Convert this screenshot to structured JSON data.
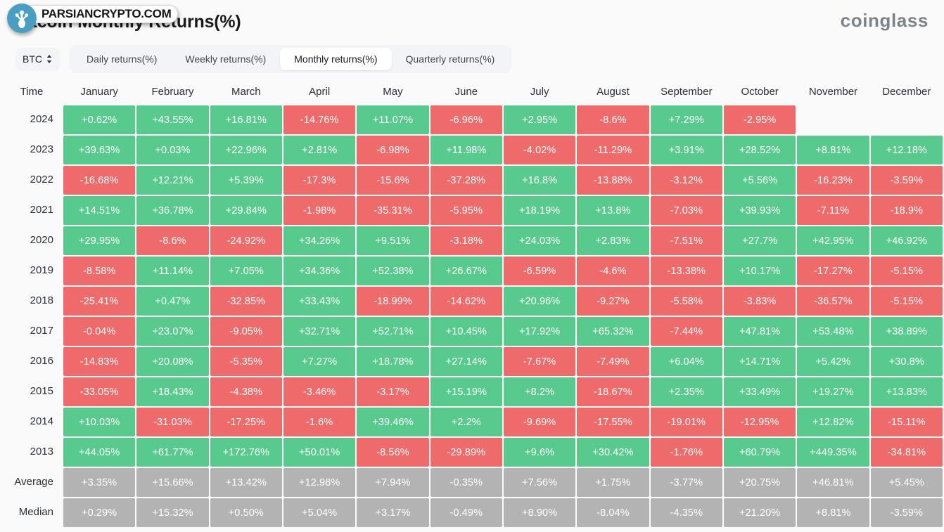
{
  "header": {
    "title": "Bitcoin Monthly Returns(%)",
    "brand": "coinglass"
  },
  "watermark": {
    "text": "PARSIANCRYPTO.COM",
    "logo_icon": "parsian-crypto-logo-icon"
  },
  "controls": {
    "coin": "BTC",
    "coin_stepper_icon": "chevron-updown-icon",
    "tabs": [
      {
        "label": "Daily returns(%)",
        "active": false
      },
      {
        "label": "Weekly returns(%)",
        "active": false
      },
      {
        "label": "Monthly returns(%)",
        "active": true
      },
      {
        "label": "Quarterly returns(%)",
        "active": false
      }
    ]
  },
  "colors": {
    "positive": "#58ca8e",
    "negative": "#ef6a6a",
    "stat": "#b3b3b3",
    "background": "#fafafa"
  },
  "chart_data": {
    "type": "heatmap",
    "title": "Bitcoin Monthly Returns(%)",
    "xlabel": "",
    "ylabel": "Time",
    "columns": [
      "Time",
      "January",
      "February",
      "March",
      "April",
      "May",
      "June",
      "July",
      "August",
      "September",
      "October",
      "November",
      "December"
    ],
    "rows": [
      {
        "label": "2024",
        "kind": "data",
        "values": [
          "+0.62%",
          "+43.55%",
          "+16.81%",
          "-14.76%",
          "+11.07%",
          "-6.96%",
          "+2.95%",
          "-8.6%",
          "+7.29%",
          "-2.95%",
          "",
          ""
        ]
      },
      {
        "label": "2023",
        "kind": "data",
        "values": [
          "+39.63%",
          "+0.03%",
          "+22.96%",
          "+2.81%",
          "-6.98%",
          "+11.98%",
          "-4.02%",
          "-11.29%",
          "+3.91%",
          "+28.52%",
          "+8.81%",
          "+12.18%"
        ]
      },
      {
        "label": "2022",
        "kind": "data",
        "values": [
          "-16.68%",
          "+12.21%",
          "+5.39%",
          "-17.3%",
          "-15.6%",
          "-37.28%",
          "+16.8%",
          "-13.88%",
          "-3.12%",
          "+5.56%",
          "-16.23%",
          "-3.59%"
        ]
      },
      {
        "label": "2021",
        "kind": "data",
        "values": [
          "+14.51%",
          "+36.78%",
          "+29.84%",
          "-1.98%",
          "-35.31%",
          "-5.95%",
          "+18.19%",
          "+13.8%",
          "-7.03%",
          "+39.93%",
          "-7.11%",
          "-18.9%"
        ]
      },
      {
        "label": "2020",
        "kind": "data",
        "values": [
          "+29.95%",
          "-8.6%",
          "-24.92%",
          "+34.26%",
          "+9.51%",
          "-3.18%",
          "+24.03%",
          "+2.83%",
          "-7.51%",
          "+27.7%",
          "+42.95%",
          "+46.92%"
        ]
      },
      {
        "label": "2019",
        "kind": "data",
        "values": [
          "-8.58%",
          "+11.14%",
          "+7.05%",
          "+34.36%",
          "+52.38%",
          "+26.67%",
          "-6.59%",
          "-4.6%",
          "-13.38%",
          "+10.17%",
          "-17.27%",
          "-5.15%"
        ]
      },
      {
        "label": "2018",
        "kind": "data",
        "values": [
          "-25.41%",
          "+0.47%",
          "-32.85%",
          "+33.43%",
          "-18.99%",
          "-14.62%",
          "+20.96%",
          "-9.27%",
          "-5.58%",
          "-3.83%",
          "-36.57%",
          "-5.15%"
        ]
      },
      {
        "label": "2017",
        "kind": "data",
        "values": [
          "-0.04%",
          "+23.07%",
          "-9.05%",
          "+32.71%",
          "+52.71%",
          "+10.45%",
          "+17.92%",
          "+65.32%",
          "-7.44%",
          "+47.81%",
          "+53.48%",
          "+38.89%"
        ]
      },
      {
        "label": "2016",
        "kind": "data",
        "values": [
          "-14.83%",
          "+20.08%",
          "-5.35%",
          "+7.27%",
          "+18.78%",
          "+27.14%",
          "-7.67%",
          "-7.49%",
          "+6.04%",
          "+14.71%",
          "+5.42%",
          "+30.8%"
        ]
      },
      {
        "label": "2015",
        "kind": "data",
        "values": [
          "-33.05%",
          "+18.43%",
          "-4.38%",
          "-3.46%",
          "-3.17%",
          "+15.19%",
          "+8.2%",
          "-18.67%",
          "+2.35%",
          "+33.49%",
          "+19.27%",
          "+13.83%"
        ]
      },
      {
        "label": "2014",
        "kind": "data",
        "values": [
          "+10.03%",
          "-31.03%",
          "-17.25%",
          "-1.6%",
          "+39.46%",
          "+2.2%",
          "-9.69%",
          "-17.55%",
          "-19.01%",
          "-12.95%",
          "+12.82%",
          "-15.11%"
        ]
      },
      {
        "label": "2013",
        "kind": "data",
        "values": [
          "+44.05%",
          "+61.77%",
          "+172.76%",
          "+50.01%",
          "-8.56%",
          "-29.89%",
          "+9.6%",
          "+30.42%",
          "-1.76%",
          "+60.79%",
          "+449.35%",
          "-34.81%"
        ]
      },
      {
        "label": "Average",
        "kind": "stat",
        "values": [
          "+3.35%",
          "+15.66%",
          "+13.42%",
          "+12.98%",
          "+7.94%",
          "-0.35%",
          "+7.56%",
          "+1.75%",
          "-3.77%",
          "+20.75%",
          "+46.81%",
          "+5.45%"
        ]
      },
      {
        "label": "Median",
        "kind": "stat",
        "values": [
          "+0.29%",
          "+15.32%",
          "+0.50%",
          "+5.04%",
          "+3.17%",
          "-0.49%",
          "+8.90%",
          "-8.04%",
          "-4.35%",
          "+21.20%",
          "+8.81%",
          "-3.59%"
        ]
      }
    ]
  }
}
